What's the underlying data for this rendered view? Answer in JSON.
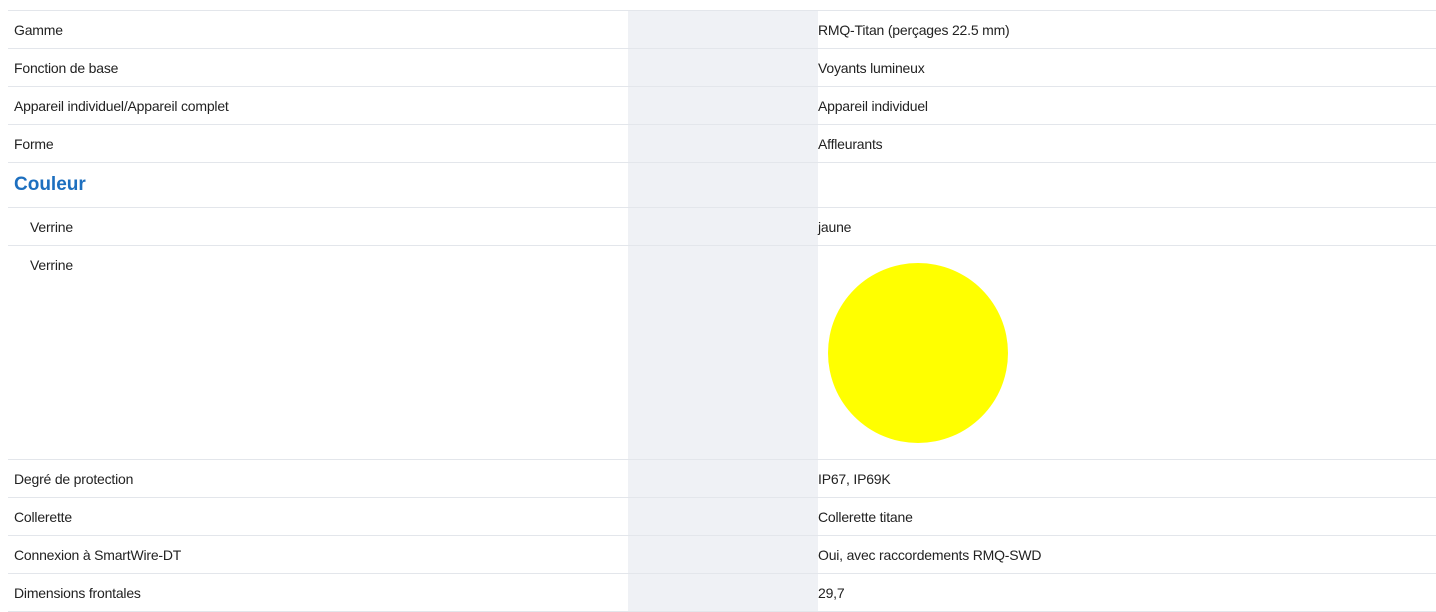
{
  "rows": [
    {
      "label": "Gamme",
      "value": "RMQ-Titan (perçages 22.5 mm)"
    },
    {
      "label": "Fonction de base",
      "value": "Voyants lumineux"
    },
    {
      "label": "Appareil individuel/Appareil complet",
      "value": "Appareil individuel"
    },
    {
      "label": "Forme",
      "value": "Affleurants"
    }
  ],
  "section": {
    "title": "Couleur"
  },
  "color_rows": [
    {
      "label": "Verrine",
      "value": "jaune"
    },
    {
      "label": "Verrine",
      "swatch_color": "#ffff00"
    }
  ],
  "rows_after": [
    {
      "label": "Degré de protection",
      "value": "IP67, IP69K"
    },
    {
      "label": "Collerette",
      "value": "Collerette titane"
    },
    {
      "label": "Connexion à SmartWire-DT",
      "value": "Oui, avec raccordements RMQ-SWD"
    },
    {
      "label": "Dimensions frontales",
      "value": "29,7"
    }
  ],
  "colors": {
    "accent": "#1d6fbf",
    "middle_column": "#eff1f5",
    "divider": "#e3e6eb"
  }
}
